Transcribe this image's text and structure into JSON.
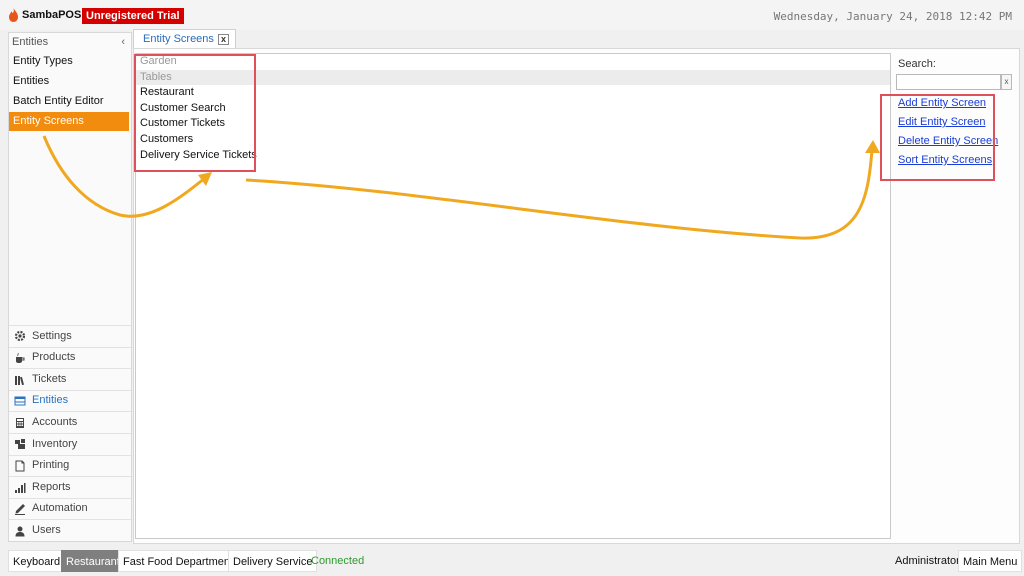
{
  "app": {
    "name": "SambaPOS",
    "trial_badge": "Unregistered Trial",
    "datetime": "Wednesday, January 24, 2018 12:42 PM"
  },
  "leftnav": {
    "header": "Entities",
    "collapse_glyph": "‹",
    "items": [
      {
        "label": "Entity Types"
      },
      {
        "label": "Entities"
      },
      {
        "label": "Batch Entity Editor"
      },
      {
        "label": "Entity Screens"
      }
    ],
    "sections": [
      {
        "label": "Settings",
        "icon": "gear-icon"
      },
      {
        "label": "Products",
        "icon": "coffee-cup-icon"
      },
      {
        "label": "Tickets",
        "icon": "books-icon"
      },
      {
        "label": "Entities",
        "icon": "table-icon"
      },
      {
        "label": "Accounts",
        "icon": "calculator-icon"
      },
      {
        "label": "Inventory",
        "icon": "boxes-icon"
      },
      {
        "label": "Printing",
        "icon": "document-icon"
      },
      {
        "label": "Reports",
        "icon": "bar-chart-icon"
      },
      {
        "label": "Automation",
        "icon": "pen-icon"
      },
      {
        "label": "Users",
        "icon": "user-icon"
      }
    ]
  },
  "tab": {
    "label": "Entity Screens",
    "close_glyph": "x"
  },
  "entity_screens": [
    {
      "label": "Garden"
    },
    {
      "label": "Tables"
    },
    {
      "label": "Restaurant"
    },
    {
      "label": "Customer Search"
    },
    {
      "label": "Customer Tickets"
    },
    {
      "label": "Customers"
    },
    {
      "label": "Delivery Service Tickets"
    }
  ],
  "sidebar": {
    "search_label": "Search:",
    "search_value": "",
    "clear_glyph": "x",
    "actions": [
      {
        "label": "Add Entity Screen"
      },
      {
        "label": "Edit Entity Screen"
      },
      {
        "label": "Delete Entity Screen"
      },
      {
        "label": "Sort Entity Screens"
      }
    ]
  },
  "statusbar": {
    "items": [
      {
        "label": "Keyboard"
      },
      {
        "label": "Restaurant"
      },
      {
        "label": "Fast Food Department"
      },
      {
        "label": "Delivery Service"
      }
    ],
    "connection": "Connected",
    "user": "Administrator",
    "main_menu": "Main Menu"
  },
  "colors": {
    "accent_orange": "#f28c0f",
    "trial_red": "#d40000",
    "annotation_red": "#e0505a",
    "annotation_arrow": "#f0a81e",
    "link_blue": "#1a3dd8",
    "connected_green": "#2e9a2e"
  }
}
